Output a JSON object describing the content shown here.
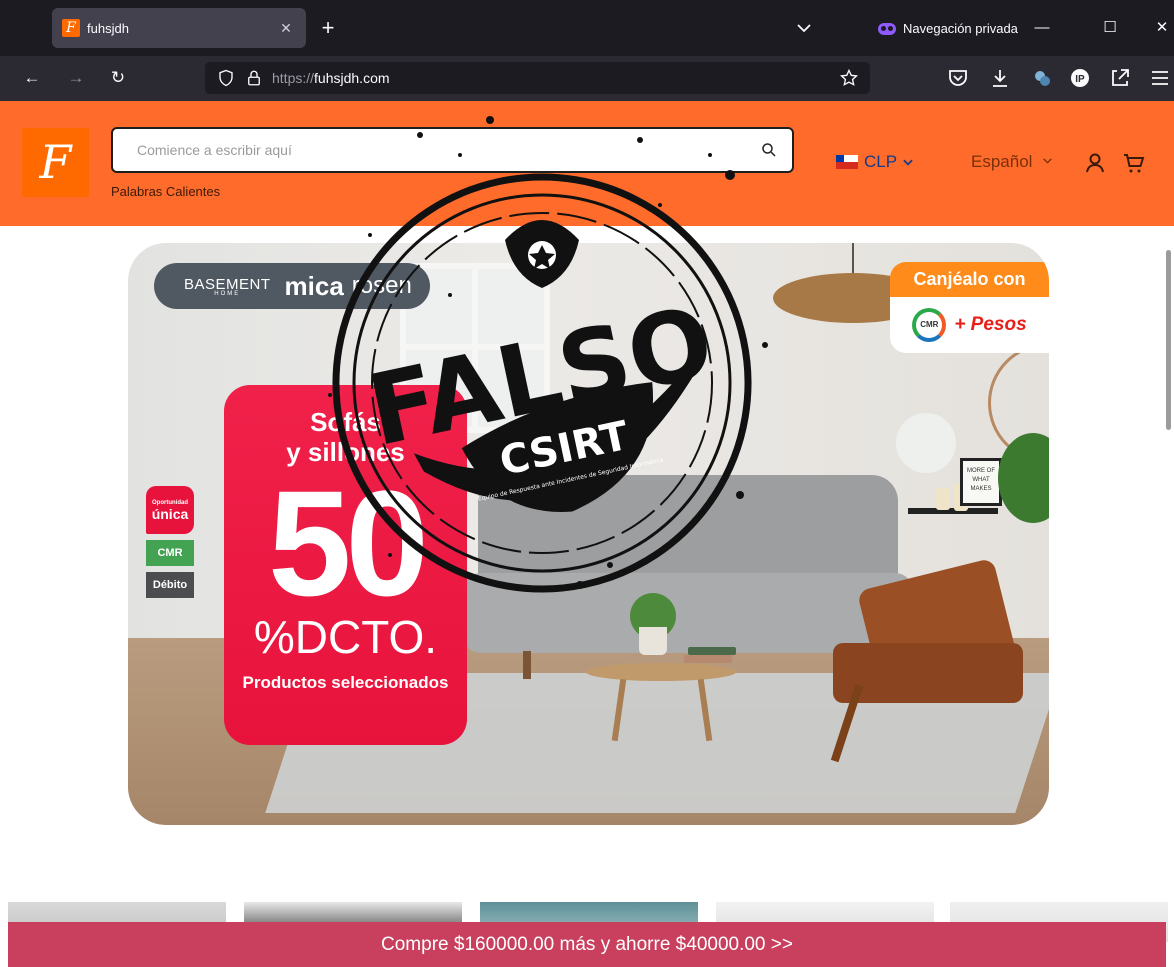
{
  "browser": {
    "tab_title": "fuhsjdh",
    "tab_favicon_letter": "F",
    "private_label": "Navegación privada",
    "url_scheme": "https://",
    "url_host": "fuhsjdh.com"
  },
  "site": {
    "logo_letter": "F",
    "search_placeholder": "Comience a escribir aquí",
    "hot_words": "Palabras Calientes",
    "currency": "CLP",
    "language": "Español"
  },
  "hero": {
    "brand_basement": "BASEMENT",
    "brand_home": "HOME",
    "brand_mica": "mica",
    "brand_rosen": "rosen",
    "canjealo": "Canjéalo con",
    "cmr_puntos": "CMR puntos",
    "pesos": "+ Pesos",
    "promo_line1": "Sofás",
    "promo_line2": "y sillones",
    "promo_number": "50",
    "promo_dcto": "%DCTO.",
    "promo_footer": "Productos seleccionados",
    "badge_oportunidad": "Oportunidad",
    "badge_unica": "única",
    "badge_cmr": "CMR",
    "badge_debito": "Débito",
    "frame_text": "MORE OF WHAT MAKES"
  },
  "stamp": {
    "word": "FALSO",
    "org": "CSIRT",
    "caption": "Equipo de Respuesta ante Incidentes de Seguridad Informática"
  },
  "promo_bar": {
    "text": "Compre $160000.00 más y ahorre $40000.00  >>"
  },
  "colors": {
    "site_header": "#ff6b2b",
    "promo_card": "#e8133c",
    "promo_bar": "#c8405e",
    "browser_dark": "#1c1b22"
  }
}
